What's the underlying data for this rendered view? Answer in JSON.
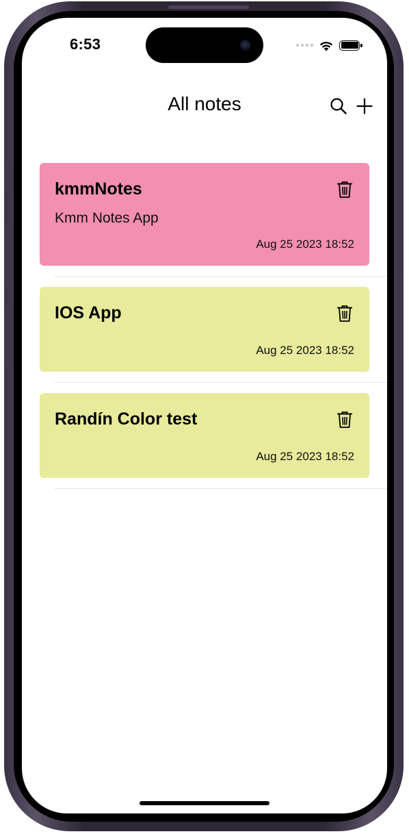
{
  "status_bar": {
    "time": "6:53"
  },
  "nav": {
    "title": "All notes",
    "search_icon": "search-icon",
    "add_icon": "plus-icon"
  },
  "notes": [
    {
      "title": "kmmNotes",
      "body": "Kmm Notes App",
      "date": "Aug 25 2023 18:52",
      "color": "#f38fb1"
    },
    {
      "title": "IOS App",
      "body": "",
      "date": "Aug 25 2023 18:52",
      "color": "#e7eb9b"
    },
    {
      "title": "Randín Color test",
      "body": "",
      "date": "Aug 25 2023 18:52",
      "color": "#e7eb9b"
    }
  ],
  "colors": {
    "accent_pink": "#f38fb1",
    "accent_yellow": "#e7eb9b",
    "text": "#000000"
  }
}
